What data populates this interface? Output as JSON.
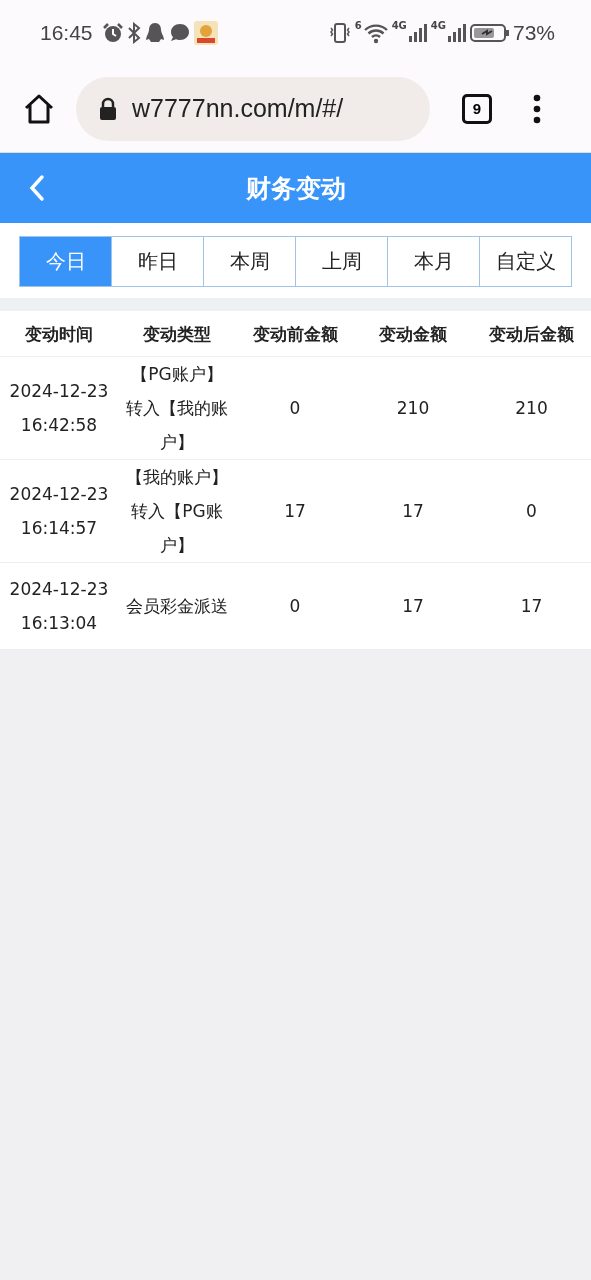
{
  "status_bar": {
    "time": "16:45",
    "wifi_label": "6",
    "network_labels": [
      "4G",
      "4G"
    ],
    "battery": "73%"
  },
  "browser": {
    "url": "w7777nn.com/m/#/",
    "tab_count": "9"
  },
  "header": {
    "title": "财务变动"
  },
  "tabs": [
    {
      "label": "今日",
      "selected": true
    },
    {
      "label": "昨日",
      "selected": false
    },
    {
      "label": "本周",
      "selected": false
    },
    {
      "label": "上周",
      "selected": false
    },
    {
      "label": "本月",
      "selected": false
    },
    {
      "label": "自定义",
      "selected": false
    }
  ],
  "table": {
    "columns": [
      "变动时间",
      "变动类型",
      "变动前金额",
      "变动金额",
      "变动后金额"
    ],
    "rows": [
      {
        "date": "2024-12-23",
        "time": "16:42:58",
        "type": "【PG账户】转入【我的账户】",
        "before": "0",
        "amount": "210",
        "after": "210"
      },
      {
        "date": "2024-12-23",
        "time": "16:14:57",
        "type": "【我的账户】转入【PG账户】",
        "before": "17",
        "amount": "17",
        "after": "0"
      },
      {
        "date": "2024-12-23",
        "time": "16:13:04",
        "type": "会员彩金派送",
        "before": "0",
        "amount": "17",
        "after": "17"
      }
    ]
  }
}
